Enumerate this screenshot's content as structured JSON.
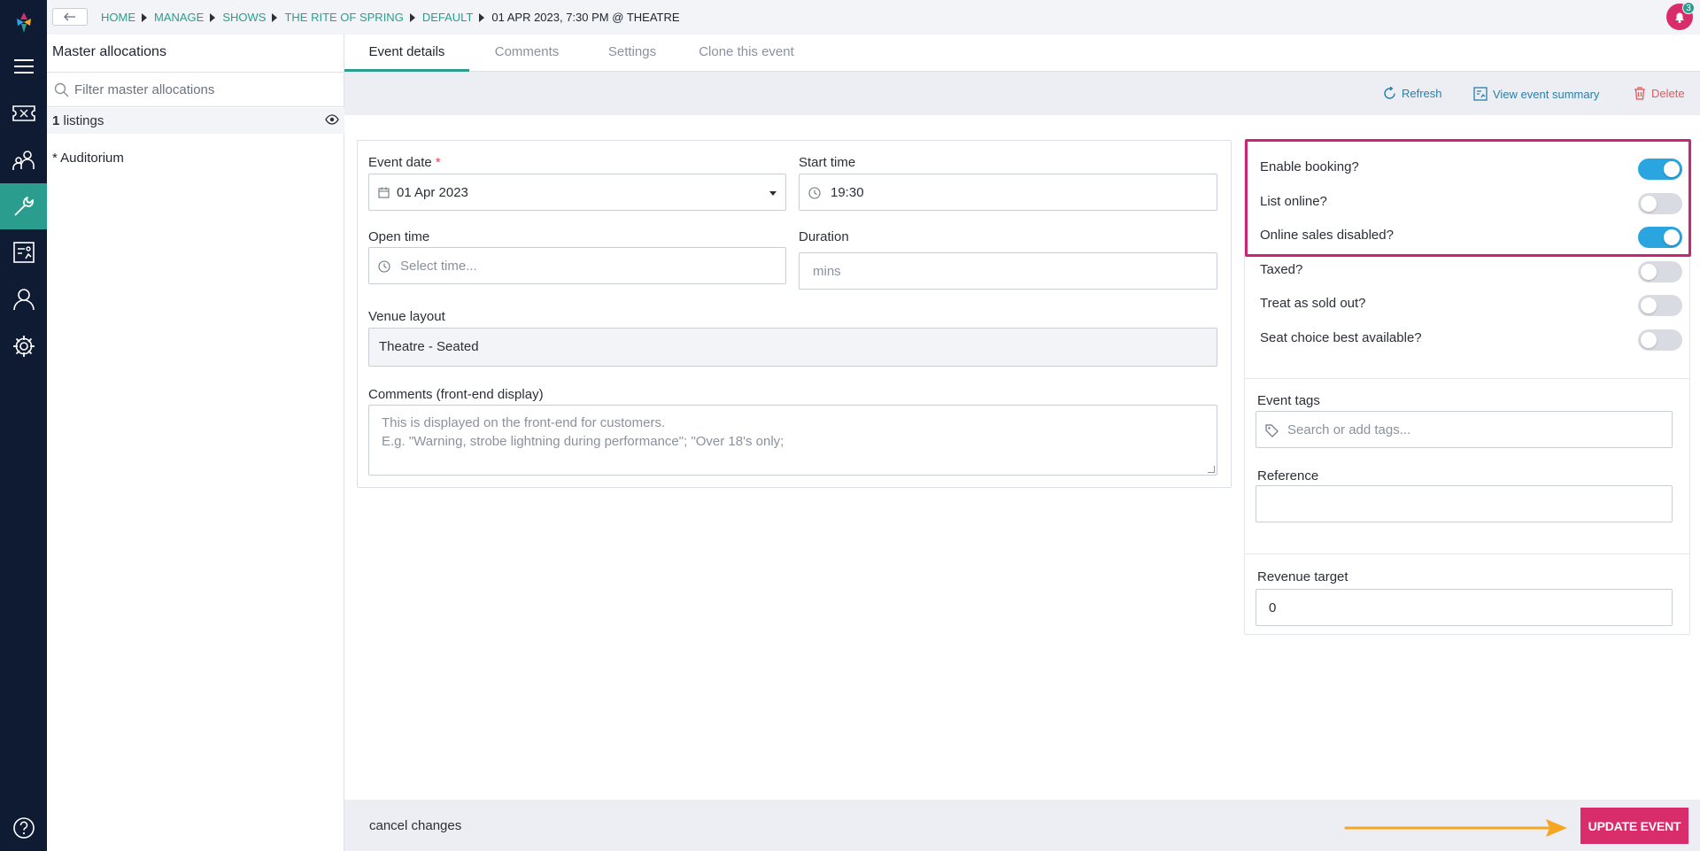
{
  "colors": {
    "accent": "#2a9d8f",
    "primary_button": "#d92d6b",
    "toggle_on": "#2aa5e0",
    "highlight": "#c7257a",
    "annotation_arrow": "#f5a623"
  },
  "breadcrumb": [
    "Home",
    "Manage",
    "Shows",
    "The Rite of Spring",
    "Default",
    "01 Apr 2023, 7:30 PM @ Theatre"
  ],
  "notifications": {
    "count": "3"
  },
  "sidebar_icons": [
    "menu-icon",
    "ticket-icon",
    "people-icon",
    "wrench-icon",
    "report-icon",
    "user-icon",
    "gear-icon",
    "help-icon"
  ],
  "master": {
    "title": "Master allocations",
    "filter_placeholder": "Filter master allocations",
    "listings_count": "1",
    "listings_label": " listings",
    "items": [
      "* Auditorium"
    ]
  },
  "tabs": [
    "Event details",
    "Comments",
    "Settings",
    "Clone this event"
  ],
  "actions": {
    "refresh": "Refresh",
    "summary": "View event summary",
    "delete": "Delete"
  },
  "form": {
    "event_date_label": "Event date",
    "required_mark": "*",
    "event_date_value": "01 Apr 2023",
    "start_time_label": "Start time",
    "start_time_value": "19:30",
    "open_time_label": "Open time",
    "open_time_placeholder": "Select time...",
    "duration_label": "Duration",
    "duration_placeholder": "mins",
    "venue_label": "Venue layout",
    "venue_value": "Theatre - Seated",
    "comments_label": "Comments (front-end display)",
    "comments_placeholder_1": "This is displayed on the front-end for customers.",
    "comments_placeholder_2": "E.g. \"Warning, strobe lightning during performance\"; \"Over 18's only;"
  },
  "toggles": [
    {
      "label": "Enable booking?",
      "on": true
    },
    {
      "label": "List online?",
      "on": false
    },
    {
      "label": "Online sales disabled?",
      "on": true
    },
    {
      "label": "Taxed?",
      "on": false
    },
    {
      "label": "Treat as sold out?",
      "on": false
    },
    {
      "label": "Seat choice best available?",
      "on": false
    }
  ],
  "tags": {
    "label": "Event tags",
    "placeholder": "Search or add tags..."
  },
  "reference": {
    "label": "Reference"
  },
  "revenue": {
    "label": "Revenue target",
    "value": "0"
  },
  "footer": {
    "cancel": "cancel changes",
    "update": "UPDATE EVENT"
  }
}
